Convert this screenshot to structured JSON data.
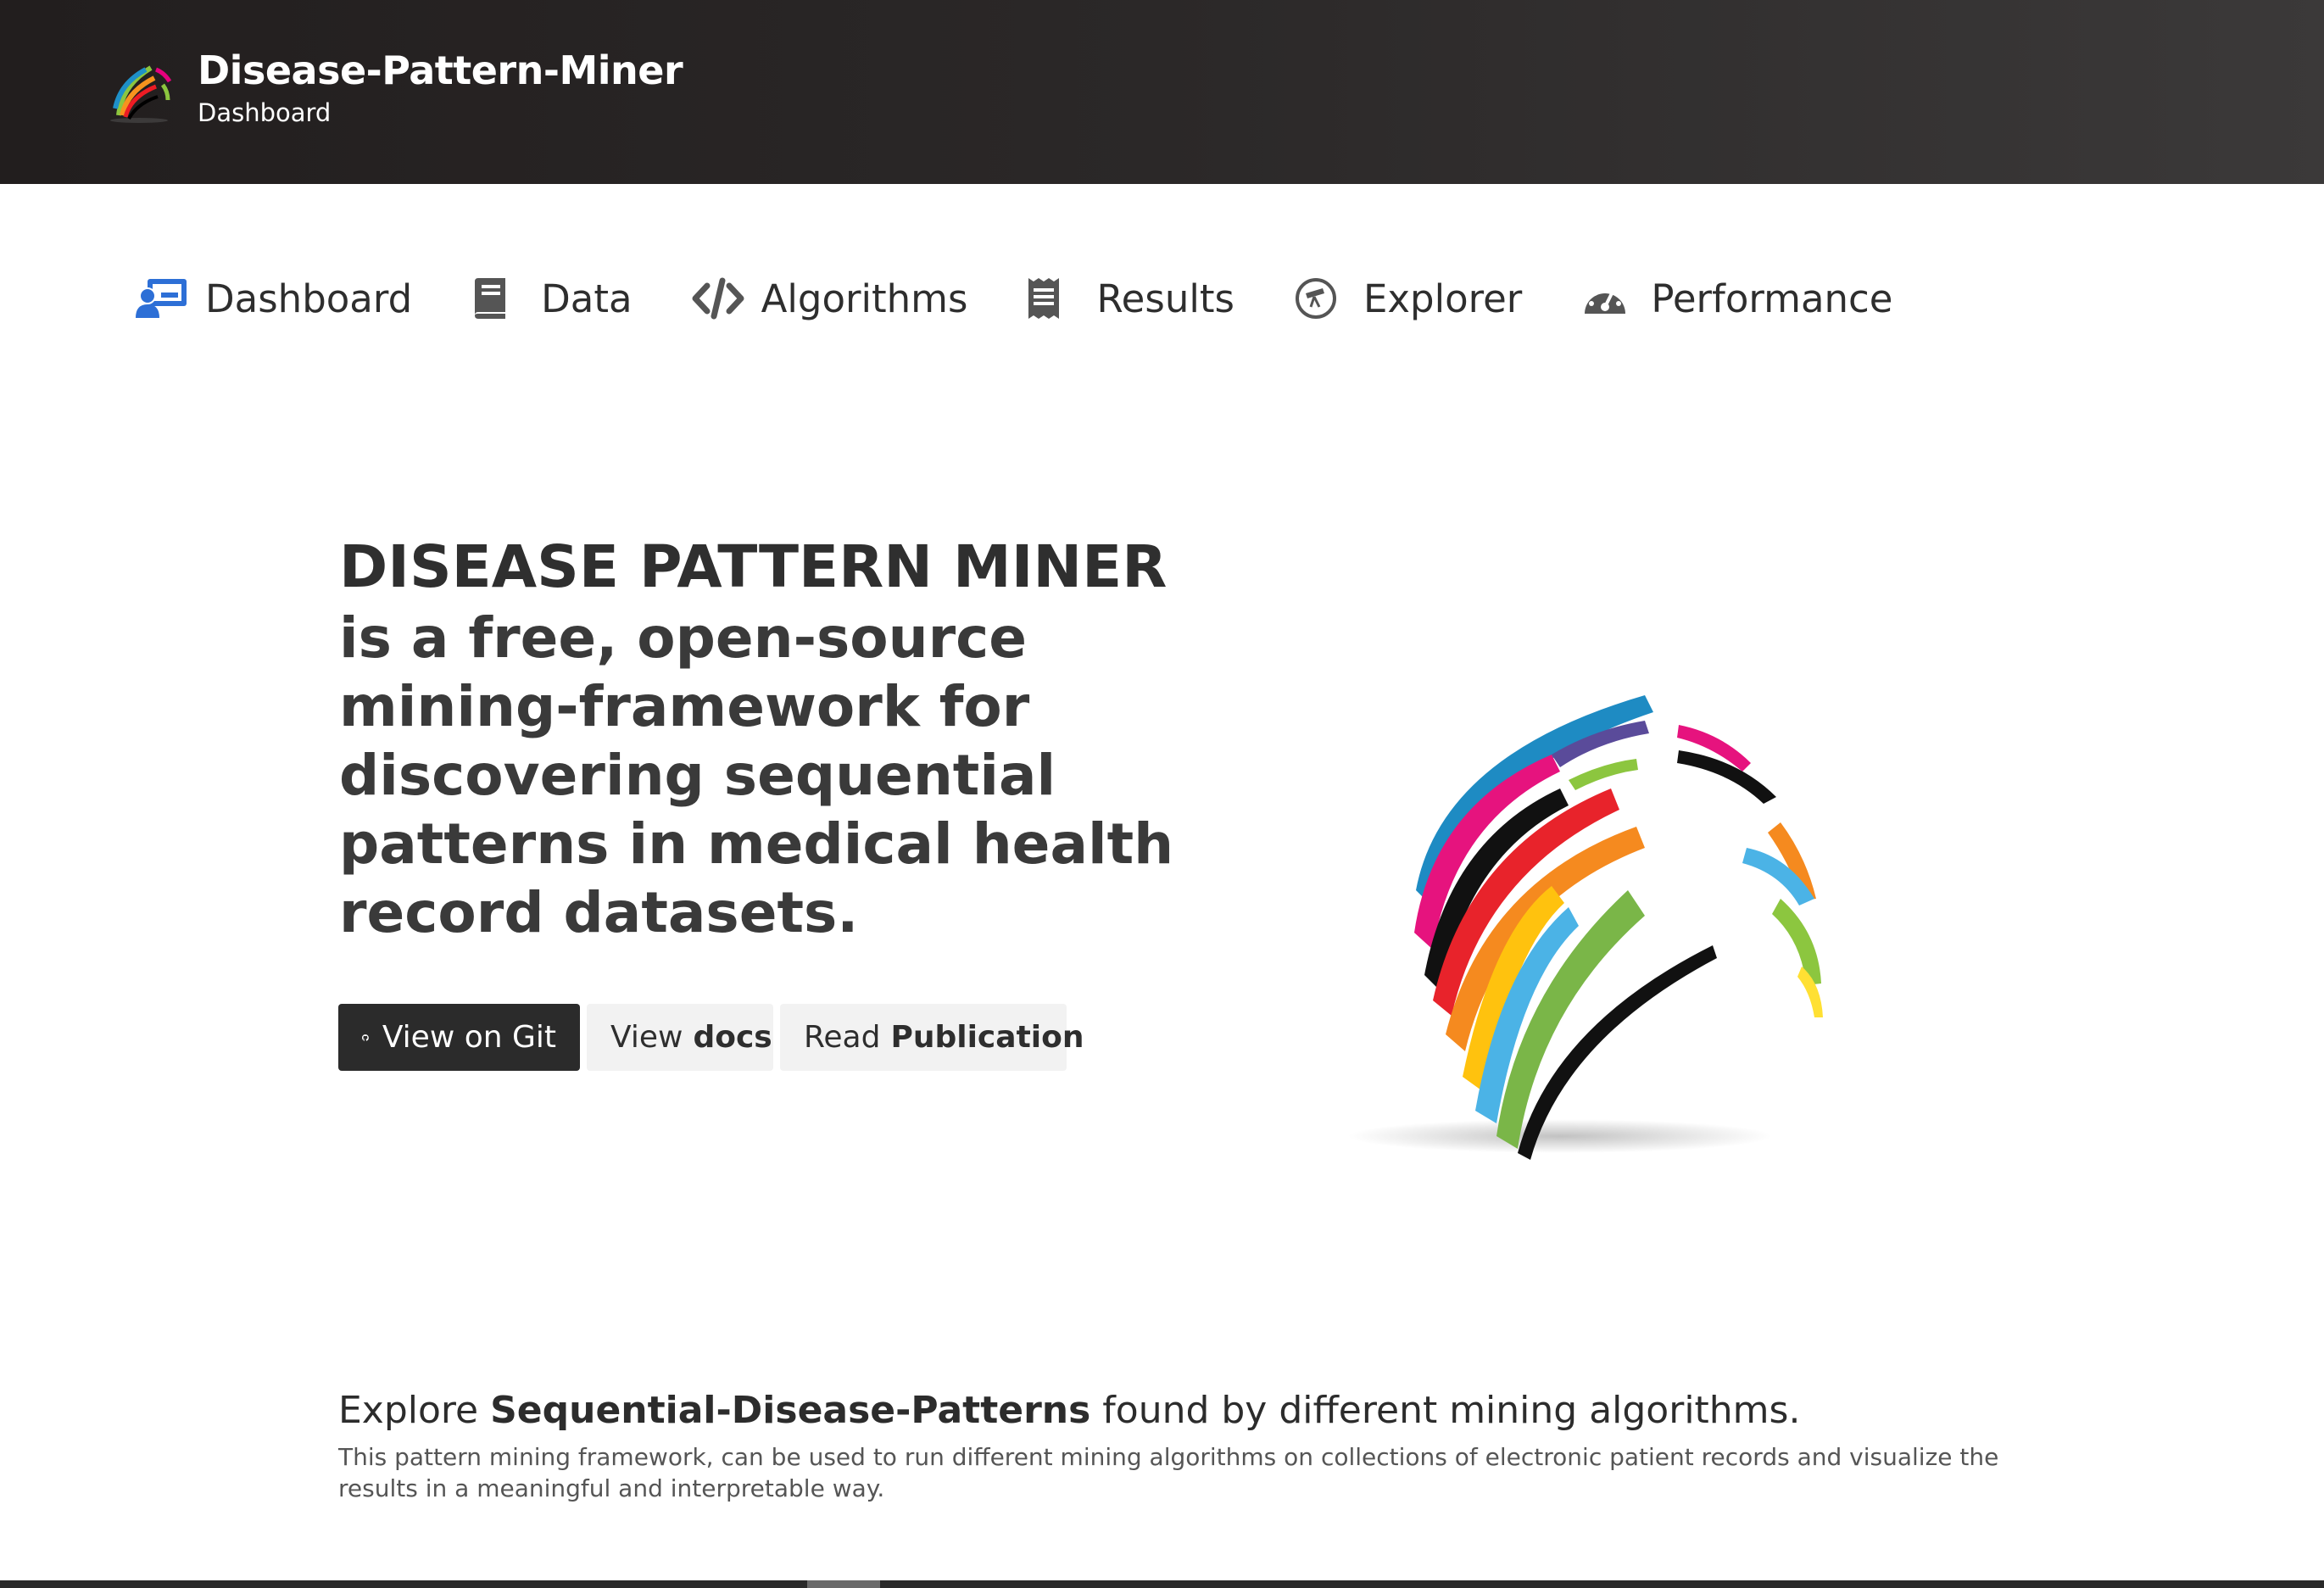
{
  "header": {
    "title": "Disease-Pattern-Miner",
    "subtitle": "Dashboard",
    "logo_icon": "rainbow-globe-logo-icon"
  },
  "nav": {
    "items": [
      {
        "label": "Dashboard",
        "icon": "presentation-user-icon",
        "color": "#2d6fd6"
      },
      {
        "label": "Data",
        "icon": "book-icon",
        "color": "#555555"
      },
      {
        "label": "Algorithms",
        "icon": "code-icon",
        "color": "#555555"
      },
      {
        "label": "Results",
        "icon": "receipt-icon",
        "color": "#555555"
      },
      {
        "label": "Explorer",
        "icon": "telescope-icon",
        "color": "#555555"
      },
      {
        "label": "Performance",
        "icon": "speedometer-icon",
        "color": "#555555"
      }
    ]
  },
  "hero": {
    "title": "DISEASE PATTERN MINER",
    "tagline_lines": [
      "is a free, open-source",
      "mining-framework for",
      "discovering sequential",
      "patterns in medical health",
      "record datasets."
    ],
    "buttons": {
      "git": {
        "label": "View on Git",
        "icon": "github-icon"
      },
      "docs": {
        "prefix": "View",
        "bold": "docs"
      },
      "publication": {
        "prefix": "Read",
        "bold": "Publication"
      }
    }
  },
  "explore": {
    "heading_prefix": "Explore",
    "heading_bold": "Sequential-Disease-Patterns",
    "heading_suffix": "found by different mining algorithms.",
    "description": "This pattern mining framework, can be used to run different mining algorithms on collections of electronic patient records and visualize the results in a meaningful and interpretable way."
  },
  "colors": {
    "header_bg": "#2b2828",
    "accent_blue": "#2d6fd6",
    "button_dark": "#2b2b2b",
    "button_light": "#f2f2f2"
  }
}
